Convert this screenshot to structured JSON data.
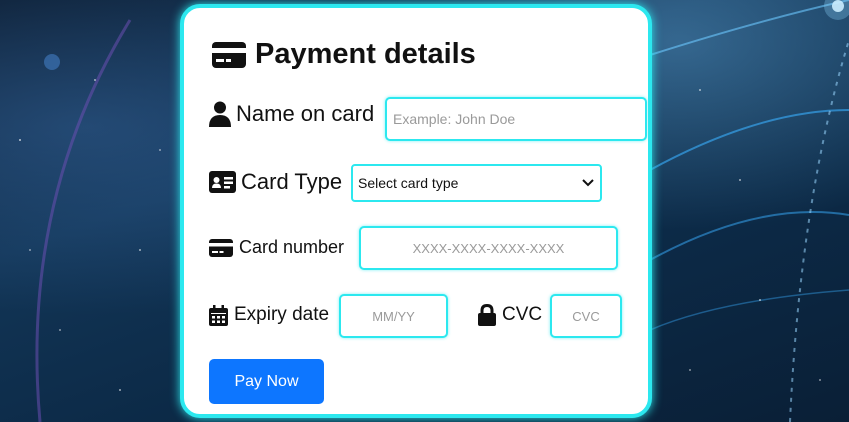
{
  "form": {
    "title": "Payment details",
    "title_icon": "credit-card-icon",
    "name": {
      "label": "Name on card",
      "icon": "user-icon",
      "value": "",
      "placeholder": "Example: John Doe"
    },
    "card_type": {
      "label": "Card Type",
      "icon": "id-card-icon",
      "selected": "Select card type"
    },
    "card_number": {
      "label": "Card number",
      "icon": "credit-card-icon",
      "value": "",
      "placeholder": "XXXX-XXXX-XXXX-XXXX"
    },
    "expiry": {
      "label": "Expiry date",
      "icon": "calendar-icon",
      "value": "",
      "placeholder": "MM/YY"
    },
    "cvc": {
      "label": "CVC",
      "icon": "lock-icon",
      "value": "",
      "placeholder": "CVC"
    },
    "submit_label": "Pay Now"
  },
  "colors": {
    "accent_border": "#2ce8ef",
    "button": "#0d76ff"
  }
}
